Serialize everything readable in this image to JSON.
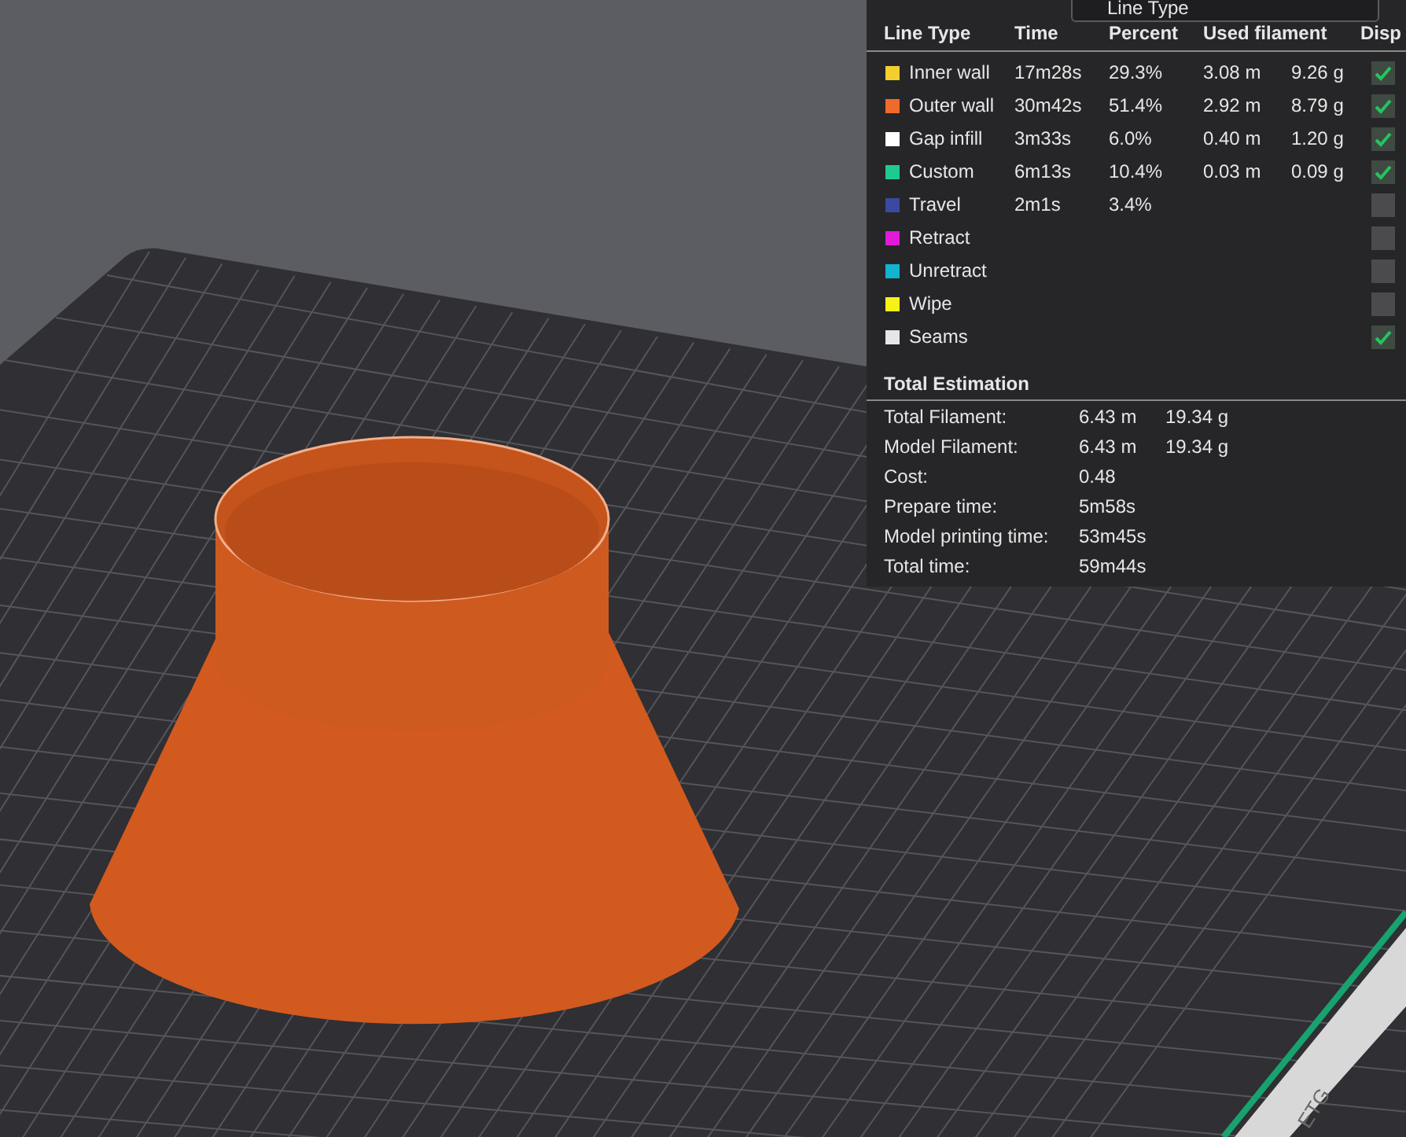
{
  "view_selector": {
    "value": "Line Type"
  },
  "legend": {
    "columns": [
      "Line Type",
      "Time",
      "Percent",
      "Used filament",
      "Disp"
    ],
    "rows": [
      {
        "name": "Inner wall",
        "color": "#f2cf2e",
        "time": "17m28s",
        "percent": "29.3%",
        "length": "3.08 m",
        "weight": "9.26 g",
        "checked": true
      },
      {
        "name": "Outer wall",
        "color": "#f06a2c",
        "time": "30m42s",
        "percent": "51.4%",
        "length": "2.92 m",
        "weight": "8.79 g",
        "checked": true
      },
      {
        "name": "Gap infill",
        "color": "#ffffff",
        "time": "3m33s",
        "percent": "6.0%",
        "length": "0.40 m",
        "weight": "1.20 g",
        "checked": true
      },
      {
        "name": "Custom",
        "color": "#1ecb8e",
        "time": "6m13s",
        "percent": "10.4%",
        "length": "0.03 m",
        "weight": "0.09 g",
        "checked": true
      },
      {
        "name": "Travel",
        "color": "#3a4aa0",
        "time": "2m1s",
        "percent": "3.4%",
        "checked": false
      },
      {
        "name": "Retract",
        "color": "#e21ad8",
        "checked": false
      },
      {
        "name": "Unretract",
        "color": "#12b3cf",
        "checked": false
      },
      {
        "name": "Wipe",
        "color": "#f6f216",
        "checked": false
      },
      {
        "name": "Seams",
        "color": "#e6e6e6",
        "checked": true
      }
    ]
  },
  "total_estimation": {
    "title": "Total Estimation",
    "rows": [
      {
        "label": "Total Filament:",
        "values": [
          "6.43 m",
          "19.34 g"
        ]
      },
      {
        "label": "Model Filament:",
        "values": [
          "6.43 m",
          "19.34 g"
        ]
      },
      {
        "label": "Cost:",
        "values": [
          "0.48"
        ]
      },
      {
        "label": "Prepare time:",
        "values": [
          "5m58s"
        ]
      },
      {
        "label": "Model printing time:",
        "values": [
          "53m45s"
        ]
      },
      {
        "label": "Total time:",
        "values": [
          "59m44s"
        ]
      }
    ]
  },
  "plate": {
    "label": "ETG"
  }
}
